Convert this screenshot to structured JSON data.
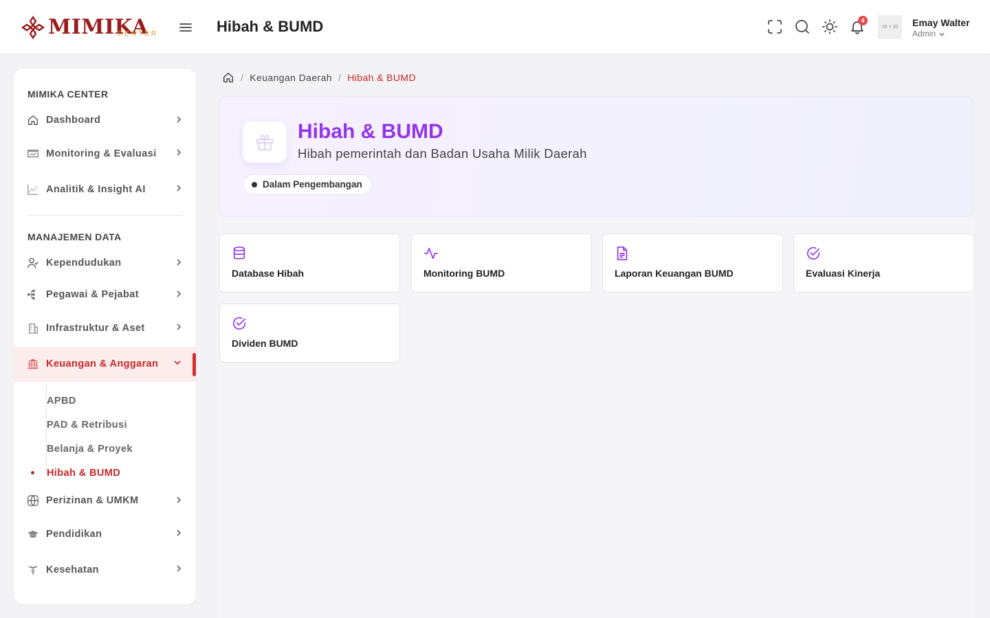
{
  "header": {
    "logo_text": "MIMIKA",
    "logo_sub": "CENTER",
    "page_title": "Hibah & BUMD",
    "notification_count": "4",
    "avatar_placeholder": "35 × 35",
    "user_name": "Emay Walter",
    "user_role": "Admin"
  },
  "sidebar": {
    "section1_title": "MIMIKA CENTER",
    "section2_title": "MANAJEMEN DATA",
    "items": [
      {
        "label": "Dashboard",
        "icon": "home-icon"
      },
      {
        "label": "Monitoring & Evaluasi",
        "icon": "monitor-icon"
      },
      {
        "label": "Analitik & Insight AI",
        "icon": "chart-icon"
      },
      {
        "label": "Kependudukan",
        "icon": "users-icon"
      },
      {
        "label": "Pegawai & Pejabat",
        "icon": "org-icon"
      },
      {
        "label": "Infrastruktur & Aset",
        "icon": "building-icon"
      },
      {
        "label": "Keuangan & Anggaran",
        "icon": "bank-icon"
      },
      {
        "label": "Perizinan & UMKM",
        "icon": "globe-icon"
      },
      {
        "label": "Pendidikan",
        "icon": "graduation-icon"
      },
      {
        "label": "Kesehatan",
        "icon": "caduceus-icon"
      }
    ],
    "submenu": [
      "APBD",
      "PAD & Retribusi",
      "Belanja & Proyek",
      "Hibah & BUMD"
    ]
  },
  "breadcrumb": {
    "parent": "Keuangan Daerah",
    "current": "Hibah & BUMD"
  },
  "hero": {
    "title": "Hibah & BUMD",
    "subtitle": "Hibah pemerintah dan Badan Usaha Milik Daerah",
    "status": "Dalam Pengembangan",
    "icon": "gift-icon"
  },
  "cards": [
    {
      "label": "Database Hibah",
      "icon": "database-icon"
    },
    {
      "label": "Monitoring BUMD",
      "icon": "activity-icon"
    },
    {
      "label": "Laporan Keuangan BUMD",
      "icon": "document-icon"
    },
    {
      "label": "Evaluasi Kinerja",
      "icon": "check-circle-icon"
    },
    {
      "label": "Dividen BUMD",
      "icon": "check-circle-icon"
    }
  ],
  "colors": {
    "brand": "#9b1c1c",
    "accent": "#c62828",
    "purple": "#9333ea",
    "logo_sub": "#e09a2b"
  }
}
